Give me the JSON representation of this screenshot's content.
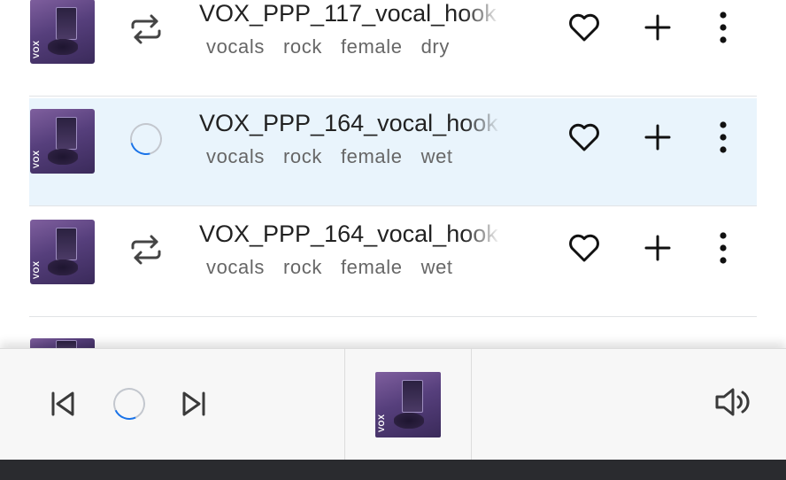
{
  "tracks": [
    {
      "title": "VOX_PPP_117_vocal_hook",
      "tags": [
        "vocals",
        "rock",
        "female",
        "dry"
      ],
      "state": "repeat",
      "art_label": "VOX",
      "active": false
    },
    {
      "title": "VOX_PPP_164_vocal_hook",
      "tags": [
        "vocals",
        "rock",
        "female",
        "wet"
      ],
      "state": "loading",
      "art_label": "VOX",
      "active": true
    },
    {
      "title": "VOX_PPP_164_vocal_hook",
      "tags": [
        "vocals",
        "rock",
        "female",
        "wet"
      ],
      "state": "repeat",
      "art_label": "VOX",
      "active": false
    }
  ],
  "row_icons": {
    "repeat": "repeat-icon",
    "loading": "loading-spinner-icon",
    "like": "heart-icon",
    "add": "plus-icon",
    "more": "more-vertical-icon"
  },
  "player": {
    "art_label": "VOX",
    "icons": [
      "skip-previous-icon",
      "loading-spinner-icon",
      "skip-next-icon",
      "volume-icon"
    ]
  },
  "colors": {
    "active_row_bg": "#e9f4fc",
    "spinner_accent": "#1a73e8",
    "bottom_bar": "#2a2b2f"
  }
}
